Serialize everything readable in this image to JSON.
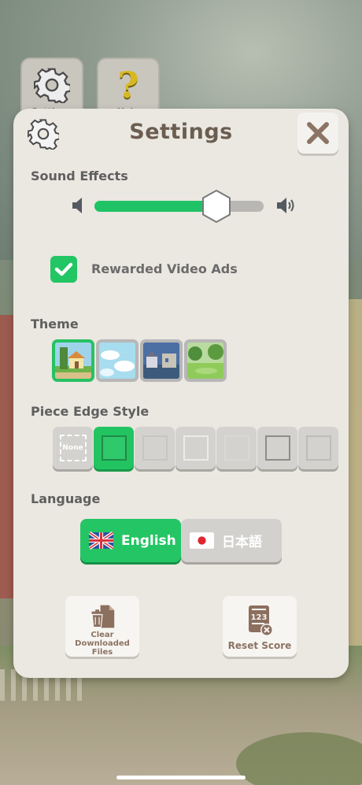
{
  "background_buttons": {
    "settings_label": "Settings",
    "help_label": "Help"
  },
  "panel": {
    "title": "Settings",
    "sound_effects": {
      "label": "Sound Effects",
      "volume_fraction": 0.72
    },
    "rewarded_ads": {
      "label": "Rewarded Video Ads",
      "checked": true
    },
    "theme": {
      "label": "Theme",
      "options": [
        "farmhouse",
        "sky",
        "town",
        "park"
      ],
      "selected_index": 0
    },
    "piece_edge_style": {
      "label": "Piece Edge Style",
      "none_label": "None",
      "option_count": 7,
      "selected_index": 1
    },
    "language": {
      "label": "Language",
      "options": [
        {
          "label": "English",
          "flag": "uk-flag-icon",
          "selected": true
        },
        {
          "label": "日本語",
          "flag": "japan-flag-icon",
          "selected": false
        }
      ]
    },
    "clear_files": {
      "label": "Clear Downloaded Files",
      "icon": "trash-file-icon"
    },
    "reset_score": {
      "label": "Reset Score",
      "icon": "score-reset-icon",
      "icon_text": "123"
    }
  },
  "colors": {
    "accent_green": "#22c665",
    "panel_bg": "#ebe7e1",
    "title_brown": "#6b5e51"
  }
}
